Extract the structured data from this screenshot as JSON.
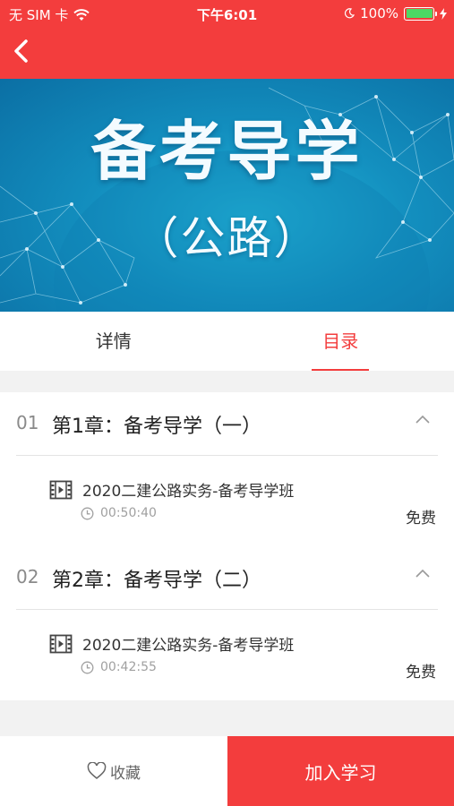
{
  "status_bar": {
    "carrier": "无 SIM 卡",
    "time": "下午6:01",
    "battery": "100%",
    "battery_level": 1.0
  },
  "nav": {
    "back_icon": "chevron-left-icon"
  },
  "banner": {
    "title": "备考导学",
    "subtitle": "（公路）"
  },
  "tabs": [
    {
      "label": "详情",
      "active": false
    },
    {
      "label": "目录",
      "active": true
    }
  ],
  "chapters": [
    {
      "number": "01",
      "title": "第1章：备考导学（一）",
      "lessons": [
        {
          "title": "2020二建公路实务-备考导学班",
          "duration": "00:50:40",
          "price": "免费"
        }
      ]
    },
    {
      "number": "02",
      "title": "第2章：备考导学（二）",
      "lessons": [
        {
          "title": "2020二建公路实务-备考导学班",
          "duration": "00:42:55",
          "price": "免费"
        }
      ]
    }
  ],
  "bottom_bar": {
    "favorite_label": "收藏",
    "join_label": "加入学习"
  },
  "colors": {
    "brand_red": "#f33d3d",
    "banner_blue": "#1a9fcd",
    "battery_green": "#4cd964"
  }
}
